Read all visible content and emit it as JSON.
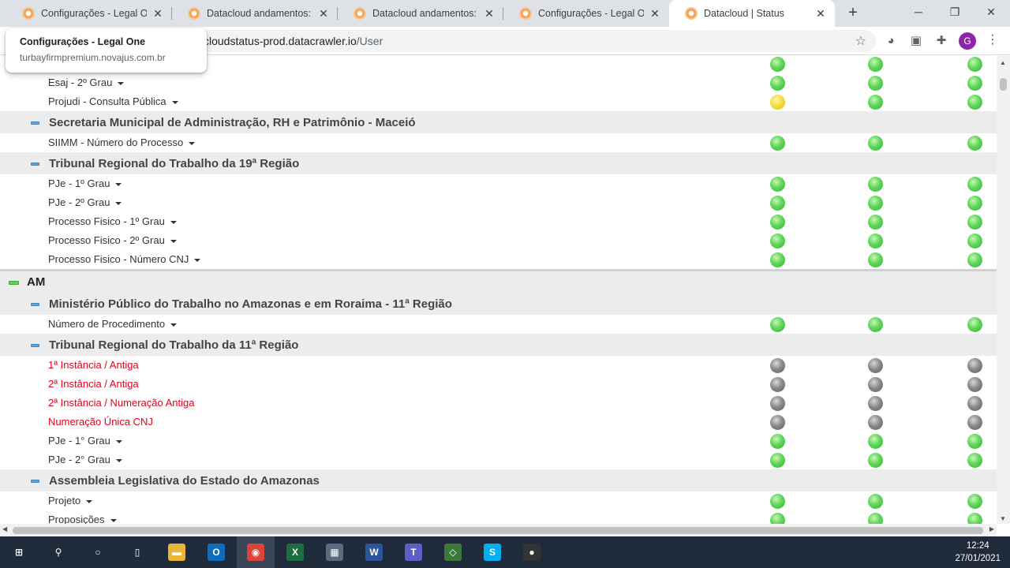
{
  "browser": {
    "tabs": [
      {
        "title": "Configurações - Legal One"
      },
      {
        "title": "Datacloud andamentos: Ag"
      },
      {
        "title": "Datacloud andamentos: Int"
      },
      {
        "title": "Configurações - Legal One"
      },
      {
        "title": "Datacloud | Status"
      }
    ],
    "close_glyph": "✕",
    "new_tab_glyph": "+",
    "url_host": "cloudstatus-prod.datacrawler.io",
    "url_path": "/User",
    "tooltip": {
      "title": "Configurações - Legal One",
      "url": "turbayfirmpremium.novajus.com.br"
    },
    "profile_initial": "G",
    "icons": [
      "star-icon",
      "circle-icon",
      "media-icon",
      "puzzle-icon"
    ]
  },
  "status_colors": {
    "green": "#5fd65a",
    "yellow": "#f5de3e",
    "gray": "#8a8a8a",
    "error_text": "#e3001b"
  },
  "rows": [
    {
      "kind": "sys",
      "name": "",
      "status": [
        "green",
        "green",
        "green"
      ]
    },
    {
      "kind": "sys",
      "name": "Esaj - 2º Grau",
      "caret": true,
      "status": [
        "green",
        "green",
        "green"
      ]
    },
    {
      "kind": "sys",
      "name": "Projudi - Consulta Pública",
      "caret": true,
      "status": [
        "yellow",
        "green",
        "green"
      ]
    },
    {
      "kind": "org",
      "name": "Secretaria Municipal de Administração, RH e Patrimônio - Maceió"
    },
    {
      "kind": "sys",
      "name": "SIIMM - Número do Processo",
      "caret": true,
      "status": [
        "green",
        "green",
        "green"
      ]
    },
    {
      "kind": "org",
      "name": "Tribunal Regional do Trabalho da 19ª Região"
    },
    {
      "kind": "sys",
      "name": "PJe - 1º Grau",
      "caret": true,
      "status": [
        "green",
        "green",
        "green"
      ]
    },
    {
      "kind": "sys",
      "name": "PJe - 2º Grau",
      "caret": true,
      "status": [
        "green",
        "green",
        "green"
      ]
    },
    {
      "kind": "sys",
      "name": "Processo Fisico - 1º Grau",
      "caret": true,
      "status": [
        "green",
        "green",
        "green"
      ]
    },
    {
      "kind": "sys",
      "name": "Processo Fisico - 2º Grau",
      "caret": true,
      "status": [
        "green",
        "green",
        "green"
      ]
    },
    {
      "kind": "sys",
      "name": "Processo Fisico - Número CNJ",
      "caret": true,
      "status": [
        "green",
        "green",
        "green"
      ]
    },
    {
      "kind": "state",
      "name": "AM"
    },
    {
      "kind": "org",
      "name": "Ministério Público do Trabalho no Amazonas e em Roraima - 11ª Região"
    },
    {
      "kind": "sys",
      "name": "Número de Procedimento",
      "caret": true,
      "status": [
        "green",
        "green",
        "green"
      ]
    },
    {
      "kind": "org",
      "name": "Tribunal Regional do Trabalho da 11ª Região"
    },
    {
      "kind": "sys",
      "name": "1ª Instância / Antiga",
      "red": true,
      "status": [
        "gray",
        "gray",
        "gray"
      ]
    },
    {
      "kind": "sys",
      "name": "2ª Instância / Antiga",
      "red": true,
      "status": [
        "gray",
        "gray",
        "gray"
      ]
    },
    {
      "kind": "sys",
      "name": "2ª Instância / Numeração Antiga",
      "red": true,
      "status": [
        "gray",
        "gray",
        "gray"
      ]
    },
    {
      "kind": "sys",
      "name": "Numeração Única CNJ",
      "red": true,
      "status": [
        "gray",
        "gray",
        "gray"
      ]
    },
    {
      "kind": "sys",
      "name": "PJe - 1° Grau",
      "caret": true,
      "status": [
        "green",
        "green",
        "green"
      ]
    },
    {
      "kind": "sys",
      "name": "PJe - 2° Grau",
      "caret": true,
      "status": [
        "green",
        "green",
        "green"
      ]
    },
    {
      "kind": "org",
      "name": "Assembleia Legislativa do Estado do Amazonas"
    },
    {
      "kind": "sys",
      "name": "Projeto",
      "caret": true,
      "status": [
        "green",
        "green",
        "green"
      ]
    },
    {
      "kind": "sys",
      "name": "Proposições",
      "caret": true,
      "status": [
        "green",
        "green",
        "green"
      ]
    }
  ],
  "taskbar": {
    "apps": [
      {
        "name": "windows-start",
        "glyph": "⊞"
      },
      {
        "name": "search",
        "glyph": "⚲"
      },
      {
        "name": "cortana",
        "glyph": "○"
      },
      {
        "name": "task-view",
        "glyph": "▯"
      },
      {
        "name": "file-explorer",
        "glyph": "▬"
      },
      {
        "name": "outlook",
        "glyph": "O"
      },
      {
        "name": "chrome",
        "glyph": "◉"
      },
      {
        "name": "excel",
        "glyph": "X"
      },
      {
        "name": "calculator",
        "glyph": "▦"
      },
      {
        "name": "word",
        "glyph": "W"
      },
      {
        "name": "teams",
        "glyph": "T"
      },
      {
        "name": "app-green",
        "glyph": "◇"
      },
      {
        "name": "skype",
        "glyph": "S"
      },
      {
        "name": "obs",
        "glyph": "●"
      }
    ],
    "time": "12:24",
    "date": "27/01/2021"
  }
}
